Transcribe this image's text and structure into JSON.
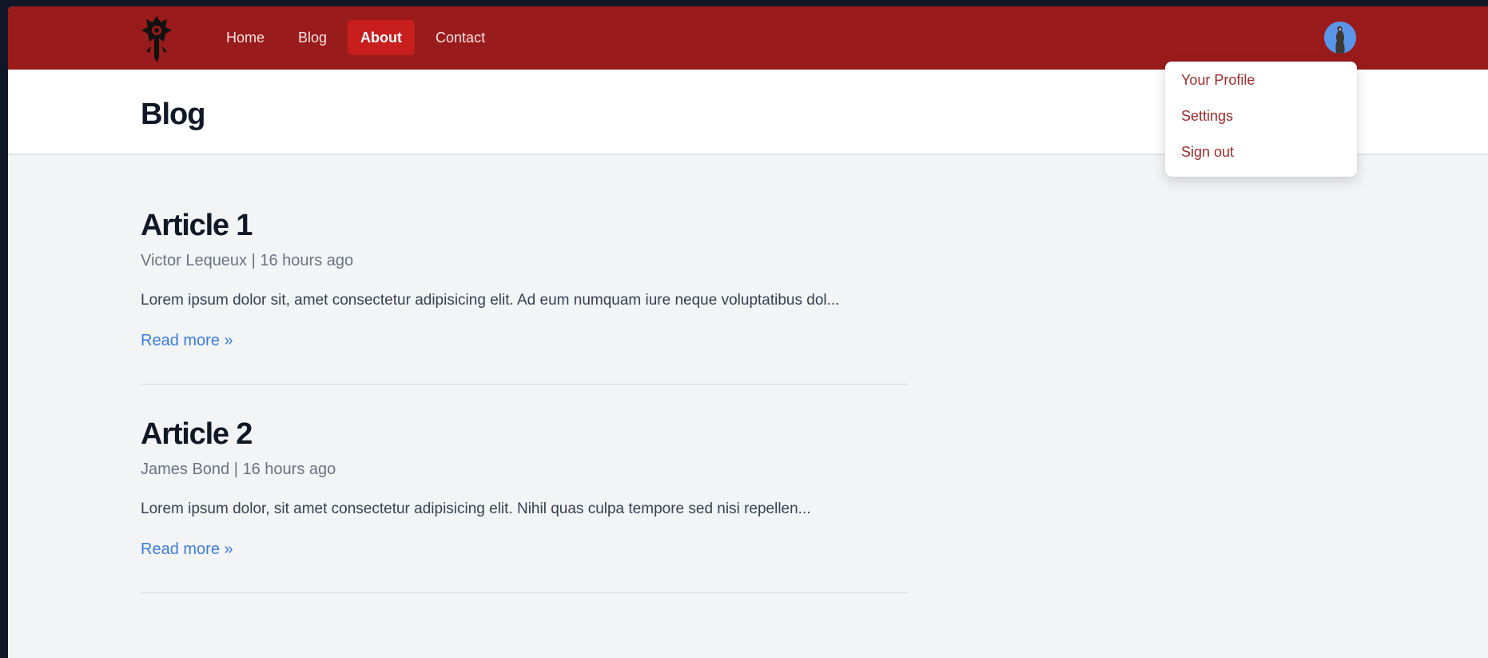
{
  "nav": {
    "links": [
      {
        "label": "Home"
      },
      {
        "label": "Blog"
      },
      {
        "label": "About",
        "active": true
      },
      {
        "label": "Contact"
      }
    ]
  },
  "header": {
    "title": "Blog"
  },
  "articles": [
    {
      "title": "Article 1",
      "meta": "Victor Lequeux | 16 hours ago",
      "excerpt": "Lorem ipsum dolor sit, amet consectetur adipisicing elit. Ad eum numquam iure neque voluptatibus dol...",
      "read_more": "Read more »"
    },
    {
      "title": "Article 2",
      "meta": "James Bond | 16 hours ago",
      "excerpt": "Lorem ipsum dolor, sit amet consectetur adipisicing elit. Nihil quas culpa tempore sed nisi repellen...",
      "read_more": "Read more »"
    }
  ],
  "user_menu": {
    "items": [
      "Your Profile",
      "Settings",
      "Sign out"
    ]
  },
  "colors": {
    "navbar": "#991b1b",
    "active_link": "#c81e1e",
    "link_blue": "#3b7ddd",
    "menu_text": "#9b2c2c"
  },
  "icons": {
    "logo": "horde-emblem-logo",
    "avatar": "user-avatar"
  }
}
